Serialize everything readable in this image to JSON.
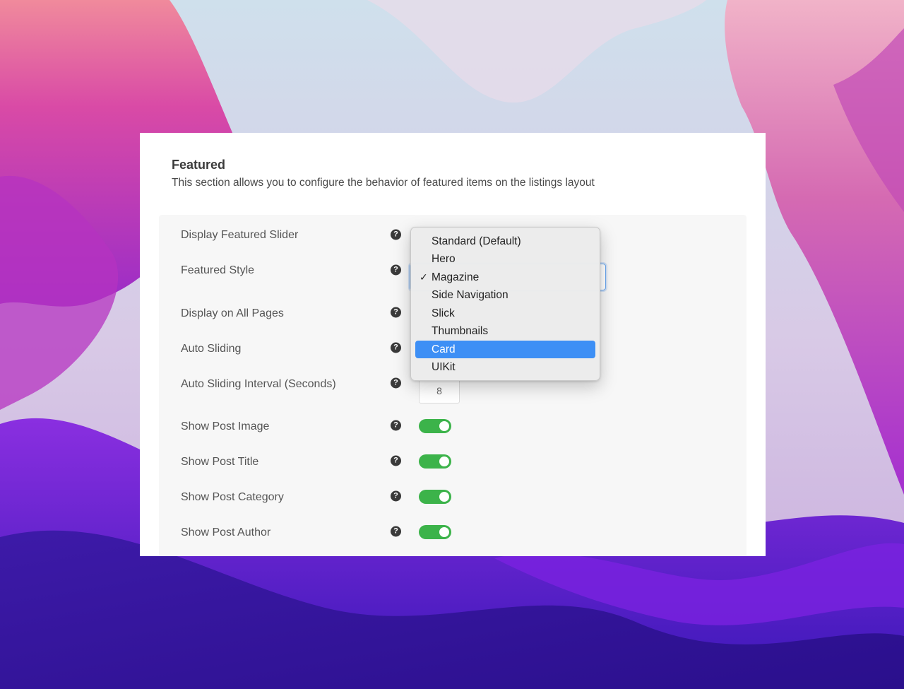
{
  "section": {
    "title": "Featured",
    "description": "This section allows you to configure the behavior of featured items on the listings layout"
  },
  "settings": [
    {
      "label": "Display Featured Slider"
    },
    {
      "label": "Featured Style"
    },
    {
      "label": "Display on All Pages"
    },
    {
      "label": "Auto Sliding"
    },
    {
      "label": "Auto Sliding Interval (Seconds)",
      "value": "8"
    },
    {
      "label": "Show Post Image",
      "enabled": true
    },
    {
      "label": "Show Post Title",
      "enabled": true
    },
    {
      "label": "Show Post Category",
      "enabled": true
    },
    {
      "label": "Show Post Author",
      "enabled": true
    }
  ],
  "help_icon": {
    "glyph": "?",
    "name": "question-circle-icon"
  },
  "dropdown": {
    "options": [
      "Standard (Default)",
      "Hero",
      "Magazine",
      "Side Navigation",
      "Slick",
      "Thumbnails",
      "Card",
      "UIKit"
    ],
    "selected": "Magazine",
    "highlighted": "Card",
    "check_glyph": "✓"
  },
  "colors": {
    "toggle_on": "#3cb34a",
    "highlight": "#3d8ff5",
    "panel_bg": "#ffffff",
    "settings_bg": "#f7f7f7"
  }
}
